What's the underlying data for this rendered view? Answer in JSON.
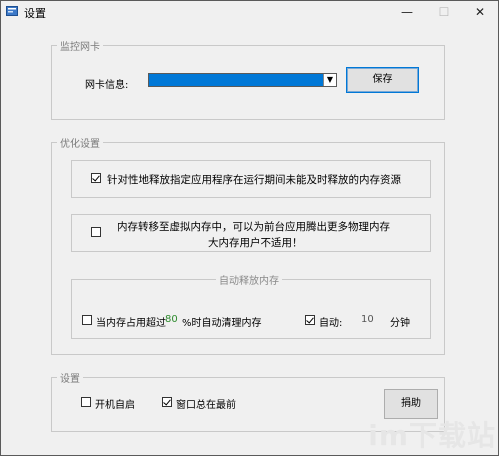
{
  "window": {
    "title": "设置",
    "icon": "settings-app-icon"
  },
  "titlebar_buttons": {
    "minimize": "—",
    "maximize": "☐",
    "close": "✕"
  },
  "monitor": {
    "group_title": "监控网卡",
    "nic_label": "网卡信息:",
    "nic_selected": "",
    "save_label": "保存"
  },
  "optimize": {
    "group_title": "优化设置",
    "option1": {
      "checked": true,
      "label": "针对性地释放指定应用程序在运行期间未能及时释放的内存资源"
    },
    "option2": {
      "checked": false,
      "line1": "内存转移至虚拟内存中，可以为前台应用腾出更多物理内存",
      "line2": "大内存用户不适用！"
    },
    "auto_release": {
      "title": "自动释放内存",
      "threshold": {
        "checked": false,
        "prefix": "当内存占用超过",
        "value": "80",
        "suffix": "%时自动清理内存"
      },
      "auto": {
        "checked": true,
        "label": "自动:",
        "value": "10",
        "unit": "分钟"
      }
    }
  },
  "settings": {
    "group_title": "设置",
    "startup": {
      "checked": false,
      "label": "开机自启"
    },
    "topmost": {
      "checked": true,
      "label": "窗口总在最前"
    },
    "donate_label": "捐助"
  },
  "colors": {
    "selection": "#0078d7",
    "value_green": "#2e8b2e",
    "focus_border": "#0078d7"
  },
  "watermark": "im下载站"
}
